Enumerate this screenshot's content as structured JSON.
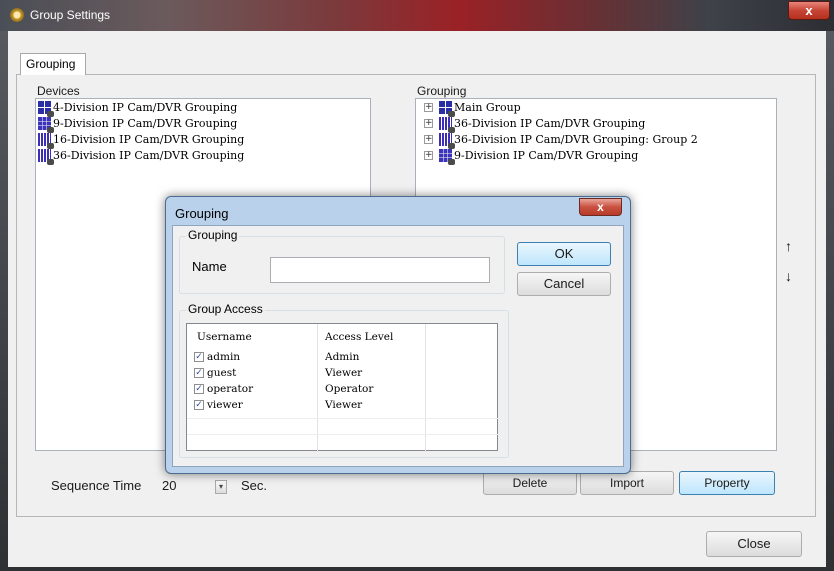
{
  "window": {
    "title": "Group Settings",
    "close_label": "x"
  },
  "tab": {
    "label": "Grouping"
  },
  "devices": {
    "label": "Devices",
    "items": [
      {
        "label": "4-Division IP Cam/DVR Grouping",
        "icon": "grid-4-icon"
      },
      {
        "label": "9-Division IP Cam/DVR Grouping",
        "icon": "grid-9-icon"
      },
      {
        "label": "16-Division IP Cam/DVR Grouping",
        "icon": "grid-16-icon"
      },
      {
        "label": "36-Division IP Cam/DVR Grouping",
        "icon": "grid-36-icon"
      }
    ]
  },
  "grouping_panel": {
    "label": "Grouping",
    "items": [
      {
        "label": "Main Group",
        "icon": "grid-4-icon"
      },
      {
        "label": "36-Division IP Cam/DVR Grouping",
        "icon": "grid-36-icon"
      },
      {
        "label": "36-Division IP Cam/DVR Grouping: Group 2",
        "icon": "grid-36-icon"
      },
      {
        "label": "9-Division IP Cam/DVR Grouping",
        "icon": "grid-9-icon"
      }
    ],
    "expand_symbol": "+",
    "move_up": "↑",
    "move_down": "↓"
  },
  "sequence": {
    "label": "Sequence Time",
    "value": "20",
    "unit": "Sec."
  },
  "buttons": {
    "delete": "Delete",
    "import": "Import",
    "property": "Property",
    "close": "Close"
  },
  "dialog": {
    "title": "Grouping",
    "close_label": "x",
    "grouping_legend": "Grouping",
    "name_label": "Name",
    "name_value": "",
    "ok": "OK",
    "cancel": "Cancel",
    "access_legend": "Group Access",
    "columns": {
      "username": "Username",
      "access": "Access Level"
    },
    "rows": [
      {
        "username": "admin",
        "access": "Admin",
        "checked": true
      },
      {
        "username": "guest",
        "access": "Viewer",
        "checked": true
      },
      {
        "username": "operator",
        "access": "Operator",
        "checked": true
      },
      {
        "username": "viewer",
        "access": "Viewer",
        "checked": true
      }
    ],
    "check_mark": "✓"
  }
}
